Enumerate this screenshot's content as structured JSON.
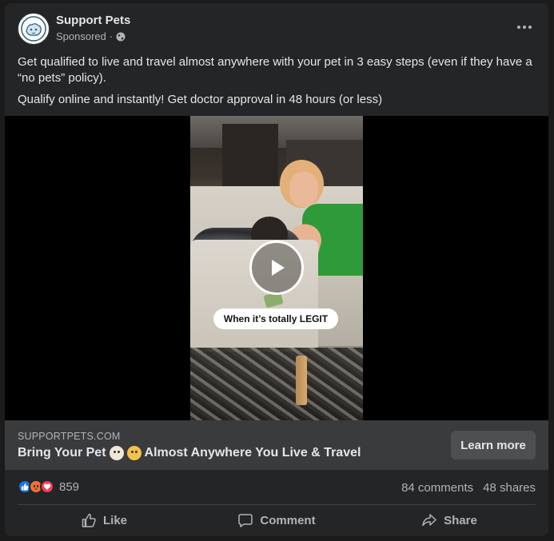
{
  "header": {
    "page_name": "Support Pets",
    "sponsored_label": "Sponsored",
    "separator": "·"
  },
  "post": {
    "paragraphs": [
      "Get qualified to live and travel almost anywhere with your pet in 3 easy steps (even if they have a “no pets” policy).",
      "Qualify online and instantly! Get doctor approval in 48 hours (or less)"
    ]
  },
  "video": {
    "caption": "When it’s totally LEGIT"
  },
  "link": {
    "domain": "SUPPORTPETS.COM",
    "headline_before": "Bring Your Pet",
    "headline_after": "Almost Anywhere You Live & Travel",
    "cta_label": "Learn more"
  },
  "stats": {
    "reaction_count": "859",
    "comments": "84 comments",
    "shares": "48 shares"
  },
  "actions": {
    "like": "Like",
    "comment": "Comment",
    "share": "Share"
  },
  "colors": {
    "background": "#242526",
    "link_bar": "#3a3b3c",
    "like_blue": "#1b74e4",
    "love_red": "#f33e58",
    "angry_orange": "#f0703a"
  }
}
